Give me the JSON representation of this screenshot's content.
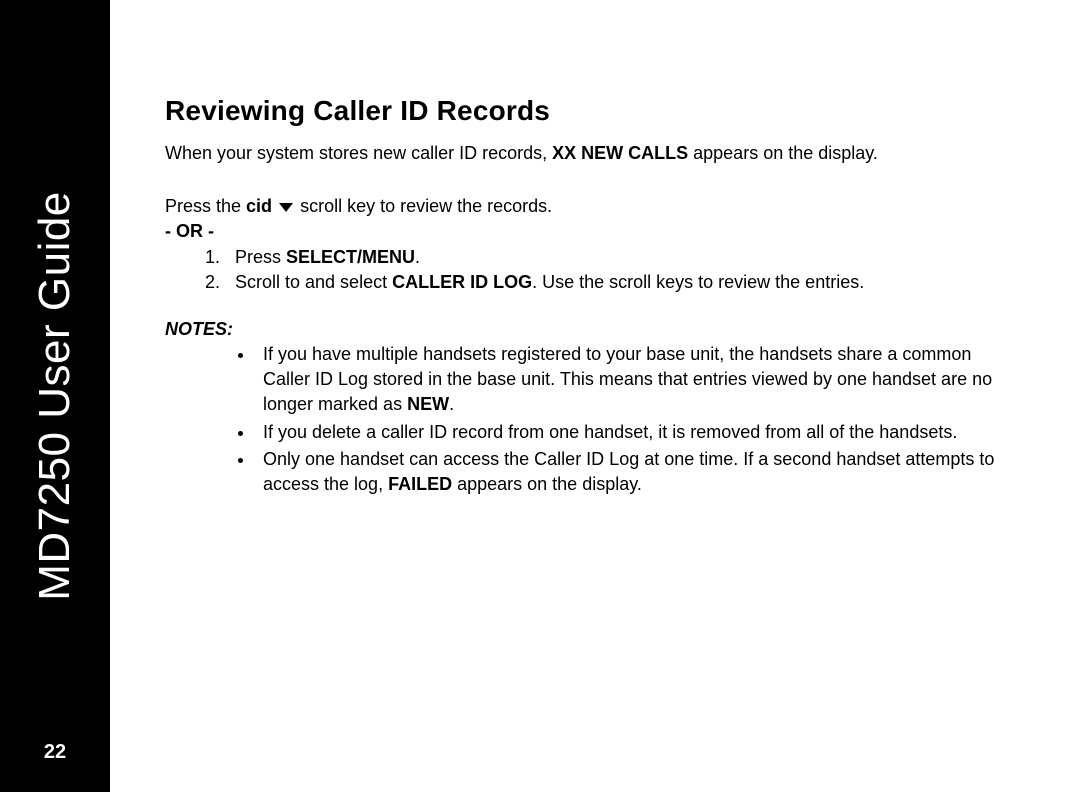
{
  "sidebar": {
    "title": "MD7250 User Guide",
    "page_number": "22"
  },
  "heading": "Reviewing Caller ID Records",
  "intro": {
    "pre": "When your system stores new caller ID records, ",
    "bold": "XX NEW CALLS",
    "post": " appears on the display."
  },
  "instruction": {
    "pre": "Press the ",
    "bold": "cid",
    "post": "  scroll key to review the records."
  },
  "or_sep": "- OR -",
  "steps": [
    {
      "pre": "Press ",
      "bold": "SELECT/MENU",
      "post": "."
    },
    {
      "pre": "Scroll to and select ",
      "bold": "CALLER ID LOG",
      "post": ". Use the scroll keys to review the entries."
    }
  ],
  "notes_label": "NOTES:",
  "notes": [
    {
      "pre": "If you have multiple handsets registered to your base unit, the handsets share a common Caller ID Log stored in the base unit. This means that entries viewed by one handset are no longer marked as ",
      "bold": "NEW",
      "post": "."
    },
    {
      "pre": "If you delete a caller ID record from one handset, it is removed from all of the handsets.",
      "bold": "",
      "post": ""
    },
    {
      "pre": "Only one handset can access the Caller ID Log at one time. If a second handset attempts to access the log, ",
      "bold": "FAILED",
      "post": " appears on the display."
    }
  ]
}
